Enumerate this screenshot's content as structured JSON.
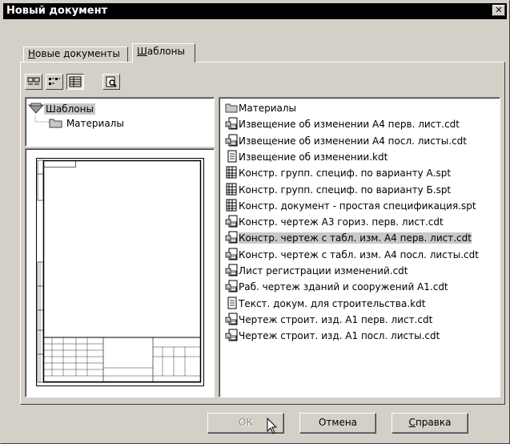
{
  "window": {
    "title": "Новый документ",
    "close_glyph": "✕"
  },
  "tabs": [
    {
      "label": "Новые документы",
      "accel": "Н",
      "rest": "овые документы",
      "active": false
    },
    {
      "label": "Шаблоны",
      "accel": "Ш",
      "rest": "аблоны",
      "active": true
    }
  ],
  "toolbar": {
    "buttons": [
      {
        "name": "large-icons-view-button",
        "icon": "large-icons-icon",
        "pressed": false
      },
      {
        "name": "list-view-button",
        "icon": "list-icon",
        "pressed": false
      },
      {
        "name": "details-view-button",
        "icon": "details-icon",
        "pressed": true
      },
      {
        "name": "preview-toggle-button",
        "icon": "preview-icon",
        "pressed": false
      }
    ]
  },
  "tree": {
    "root": {
      "label": "Шаблоны",
      "icon": "templates-root-icon",
      "selected": true
    },
    "children": [
      {
        "label": "Материалы",
        "icon": "folder-icon"
      }
    ]
  },
  "files": [
    {
      "name": "Материалы",
      "icon": "folder-icon"
    },
    {
      "name": "Извещение об изменении А4 перв. лист.cdt",
      "icon": "drawing-file-icon"
    },
    {
      "name": "Извещение об изменении А4 посл. листы.cdt",
      "icon": "drawing-file-icon"
    },
    {
      "name": "Извещение об изменении.kdt",
      "icon": "text-doc-file-icon"
    },
    {
      "name": "Констр. групп. специф. по варианту А.spt",
      "icon": "spec-file-icon"
    },
    {
      "name": "Констр. групп. специф. по варианту Б.spt",
      "icon": "spec-file-icon"
    },
    {
      "name": "Констр. документ - простая спецификация.spt",
      "icon": "spec-file-icon"
    },
    {
      "name": "Констр. чертеж А3 гориз. перв. лист.cdt",
      "icon": "drawing-file-icon"
    },
    {
      "name": "Констр. чертеж с табл. изм. А4 перв. лист.cdt",
      "icon": "drawing-file-icon",
      "selected": true
    },
    {
      "name": "Констр. чертеж с табл. изм. А4 посл. листы.cdt",
      "icon": "drawing-file-icon"
    },
    {
      "name": "Лист регистрации изменений.cdt",
      "icon": "drawing-file-icon"
    },
    {
      "name": "Раб. чертеж зданий и сооружений А1.cdt",
      "icon": "drawing-file-icon"
    },
    {
      "name": "Текст. докум. для строительства.kdt",
      "icon": "text-doc-file-icon"
    },
    {
      "name": "Чертеж  строит. изд. А1 перв. лист.cdt",
      "icon": "drawing-file-icon"
    },
    {
      "name": "Чертеж  строит. изд. А1 посл. листы.cdt",
      "icon": "drawing-file-icon"
    }
  ],
  "buttons": {
    "ok": {
      "label": "ОК",
      "enabled": false
    },
    "cancel": {
      "label": "Отмена"
    },
    "help": {
      "label": "Справка",
      "accel": "С",
      "rest": "правка"
    }
  },
  "colors": {
    "face": "#d4d0c8",
    "title_bg": "#000000",
    "selection": "#c8c8c8"
  }
}
